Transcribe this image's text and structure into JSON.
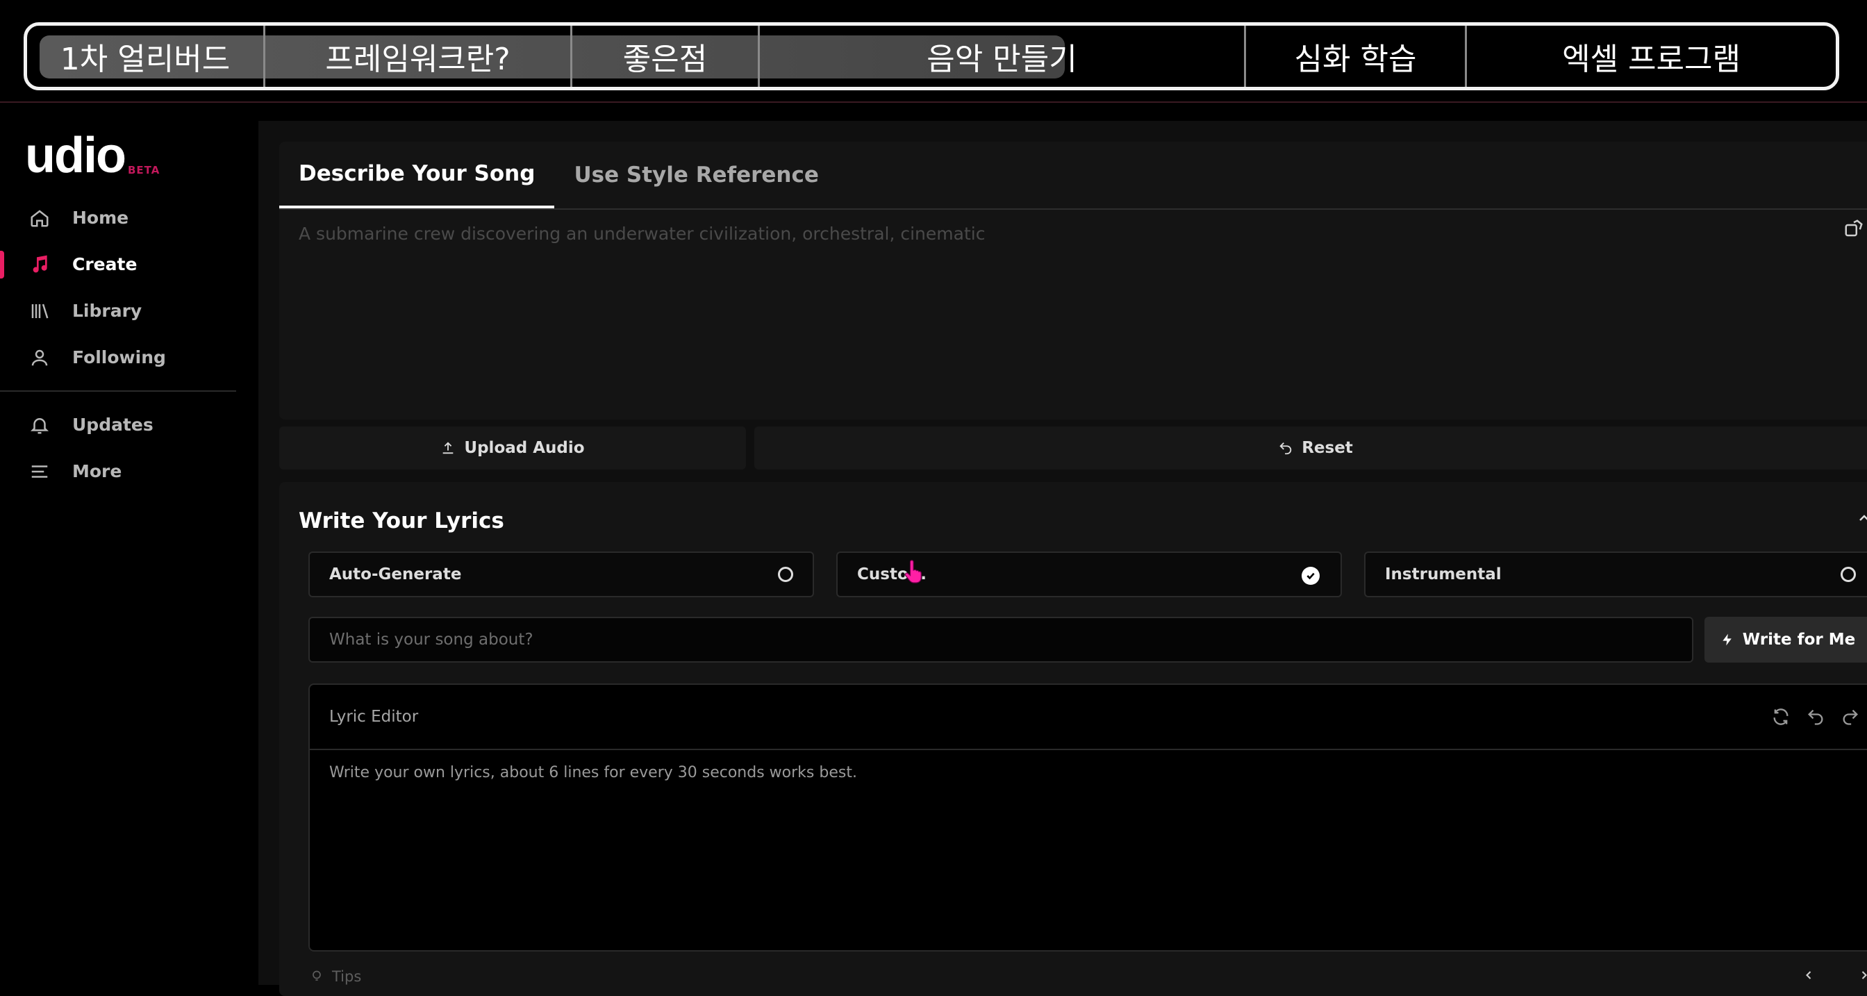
{
  "overlay_nav": {
    "segments": [
      "1차 얼리버드",
      "프레임워크란?",
      "좋은점",
      "음악 만들기",
      "심화 학습",
      "엑셀 프로그램"
    ],
    "progress": 0.55
  },
  "app": {
    "logo": "udio",
    "logo_badge": "BETA"
  },
  "sidebar": {
    "items": [
      {
        "label": "Home",
        "icon": "home-icon",
        "active": false
      },
      {
        "label": "Create",
        "icon": "music-note-icon",
        "active": true
      },
      {
        "label": "Library",
        "icon": "library-icon",
        "active": false
      },
      {
        "label": "Following",
        "icon": "user-icon",
        "active": false
      },
      {
        "label": "Updates",
        "icon": "bell-icon",
        "active": false
      },
      {
        "label": "More",
        "icon": "menu-icon",
        "active": false
      }
    ]
  },
  "composer": {
    "tabs": [
      {
        "label": "Describe Your Song",
        "active": true
      },
      {
        "label": "Use Style Reference",
        "active": false
      }
    ],
    "prompt_placeholder": "A submarine crew discovering an underwater civilization, orchestral, cinematic",
    "upload_label": "Upload Audio",
    "reset_label": "Reset"
  },
  "lyrics": {
    "title": "Write Your Lyrics",
    "options": [
      {
        "label": "Auto-Generate",
        "selected": false
      },
      {
        "label": "Custo...",
        "selected": true
      },
      {
        "label": "Instrumental",
        "selected": false
      }
    ],
    "about_placeholder": "What is your song about?",
    "write_label": "Write for Me",
    "editor_title": "Lyric Editor",
    "editor_placeholder": "Write your own lyrics, about 6 lines for every 30 seconds works best.",
    "tips_label": "Tips"
  },
  "colors": {
    "accent": "#e91e63",
    "background": "#000000",
    "panel": "#141414"
  }
}
